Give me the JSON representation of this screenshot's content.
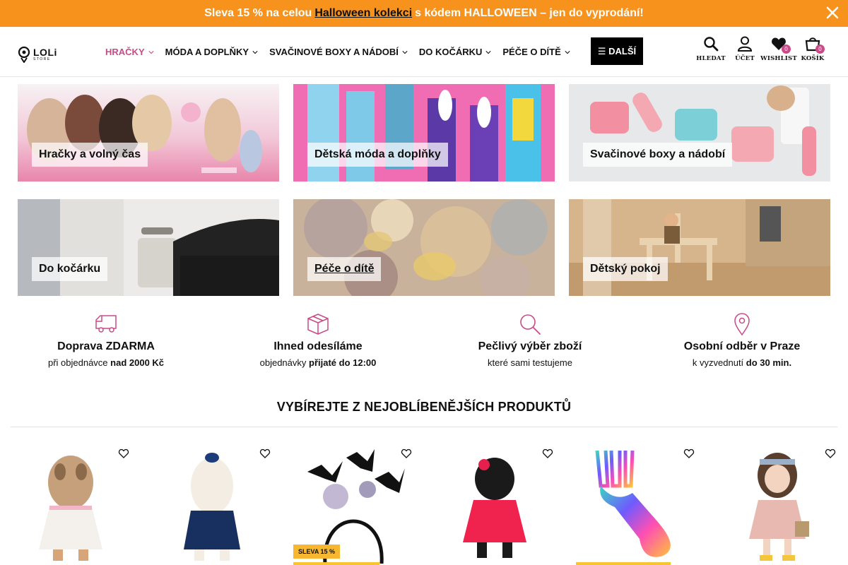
{
  "promo": {
    "text_before": "Sleva 15 % na celou",
    "link": "Halloween kolekci",
    "text_after": "s kódem HALLOWEEN – jen do vyprodání!",
    "bg_color": "#f7931d"
  },
  "header": {
    "logo": {
      "main": "LOLi",
      "sub": "STORE"
    },
    "nav": [
      {
        "label": "HRAČKY",
        "active": true
      },
      {
        "label": "MÓDA A DOPLŇKY"
      },
      {
        "label": "SVAČINOVÉ BOXY A NÁDOBÍ"
      },
      {
        "label": "DO KOČÁRKU"
      },
      {
        "label": "PÉČE O DÍTĚ"
      }
    ],
    "more": "☰ DALŠÍ",
    "tools": {
      "search": "HLEDAT",
      "account": "ÚČET",
      "wishlist": "WISHLIST",
      "wishlist_count": "0",
      "cart": "KOŠÍK",
      "cart_count": "0"
    },
    "accent_color": "#c84b87"
  },
  "categories": [
    {
      "label": "Hračky a volný čas"
    },
    {
      "label": "Dětská móda a doplňky"
    },
    {
      "label": "Svačinové boxy a nádobí"
    },
    {
      "label": "Do kočárku"
    },
    {
      "label": "Péče o dítě"
    },
    {
      "label": "Dětský pokoj"
    }
  ],
  "features": [
    {
      "icon": "truck-icon",
      "title": "Doprava ZDARMA",
      "sub_pre": "při objednávce",
      "sub_bold": "nad 2000 Kč"
    },
    {
      "icon": "box-icon",
      "title": "Ihned odesíláme",
      "sub_pre": "objednávky",
      "sub_bold": "přijaté do 12:00"
    },
    {
      "icon": "magnifier-icon",
      "title": "Pečlivý výběr zboží",
      "sub_pre": "které sami testujeme",
      "sub_bold": ""
    },
    {
      "icon": "location-pin-icon",
      "title": "Osobní odběr v Praze",
      "sub_pre": "k vyzvednutí",
      "sub_bold": "do 30 min."
    }
  ],
  "popular": {
    "title": "VYBÍREJTE Z NEJOBLÍBENĚJŠÍCH PRODUKTŮ",
    "products": [
      {
        "image": "plush-yorkshire-dog-white-dress"
      },
      {
        "image": "plush-white-dog-navy-dress"
      },
      {
        "image": "halloween-bat-headband",
        "badge": "SLEVA 15 %"
      },
      {
        "image": "plush-black-cat-pink-dress"
      },
      {
        "image": "rainbow-spork"
      },
      {
        "image": "doll-pink-dress-basket"
      }
    ]
  }
}
